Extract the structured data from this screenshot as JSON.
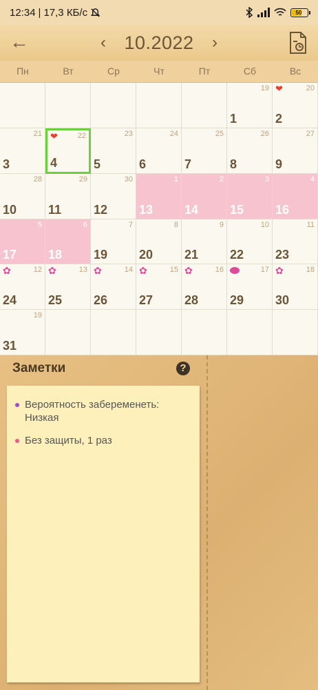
{
  "status_bar": {
    "time": "12:34",
    "net_speed": "17,3 КБ/с",
    "battery": "50"
  },
  "header": {
    "month_title": "10.2022"
  },
  "weekdays": [
    "Пн",
    "Вт",
    "Ср",
    "Чт",
    "Пт",
    "Сб",
    "Вс"
  ],
  "calendar": {
    "days": [
      {
        "day": "",
        "cycle": ""
      },
      {
        "day": "",
        "cycle": ""
      },
      {
        "day": "",
        "cycle": ""
      },
      {
        "day": "",
        "cycle": ""
      },
      {
        "day": "",
        "cycle": ""
      },
      {
        "day": "1",
        "cycle": "19"
      },
      {
        "day": "2",
        "cycle": "20",
        "mark": "heart"
      },
      {
        "day": "3",
        "cycle": "21"
      },
      {
        "day": "4",
        "cycle": "22",
        "mark": "heart",
        "selected": true
      },
      {
        "day": "5",
        "cycle": "23"
      },
      {
        "day": "6",
        "cycle": "24"
      },
      {
        "day": "7",
        "cycle": "25"
      },
      {
        "day": "8",
        "cycle": "26"
      },
      {
        "day": "9",
        "cycle": "27"
      },
      {
        "day": "10",
        "cycle": "28"
      },
      {
        "day": "11",
        "cycle": "29"
      },
      {
        "day": "12",
        "cycle": "30"
      },
      {
        "day": "13",
        "cycle": "1",
        "fertile": true
      },
      {
        "day": "14",
        "cycle": "2",
        "fertile": true
      },
      {
        "day": "15",
        "cycle": "3",
        "fertile": true
      },
      {
        "day": "16",
        "cycle": "4",
        "fertile": true
      },
      {
        "day": "17",
        "cycle": "5",
        "fertile": true
      },
      {
        "day": "18",
        "cycle": "6",
        "fertile": true
      },
      {
        "day": "19",
        "cycle": "7"
      },
      {
        "day": "20",
        "cycle": "8"
      },
      {
        "day": "21",
        "cycle": "9"
      },
      {
        "day": "22",
        "cycle": "10"
      },
      {
        "day": "23",
        "cycle": "11"
      },
      {
        "day": "24",
        "cycle": "12",
        "mark": "flower"
      },
      {
        "day": "25",
        "cycle": "13",
        "mark": "flower"
      },
      {
        "day": "26",
        "cycle": "14",
        "mark": "flower"
      },
      {
        "day": "27",
        "cycle": "15",
        "mark": "flower"
      },
      {
        "day": "28",
        "cycle": "16",
        "mark": "flower"
      },
      {
        "day": "29",
        "cycle": "17",
        "mark": "pill"
      },
      {
        "day": "30",
        "cycle": "18",
        "mark": "flower"
      },
      {
        "day": "31",
        "cycle": "19"
      },
      {
        "day": "",
        "cycle": ""
      },
      {
        "day": "",
        "cycle": ""
      },
      {
        "day": "",
        "cycle": ""
      },
      {
        "day": "",
        "cycle": ""
      },
      {
        "day": "",
        "cycle": ""
      },
      {
        "day": "",
        "cycle": ""
      }
    ]
  },
  "notes": {
    "title": "Заметки",
    "help": "?",
    "items": [
      {
        "text": "Вероятность забеременеть: Низкая",
        "color": "#9b4fc9"
      },
      {
        "text": "Без защиты, 1 раз",
        "color": "#f05a8a"
      }
    ]
  },
  "colors": {
    "fertile": "#f7c3cf",
    "selected_border": "#6bd03a",
    "accent_brown": "#6b5538"
  }
}
